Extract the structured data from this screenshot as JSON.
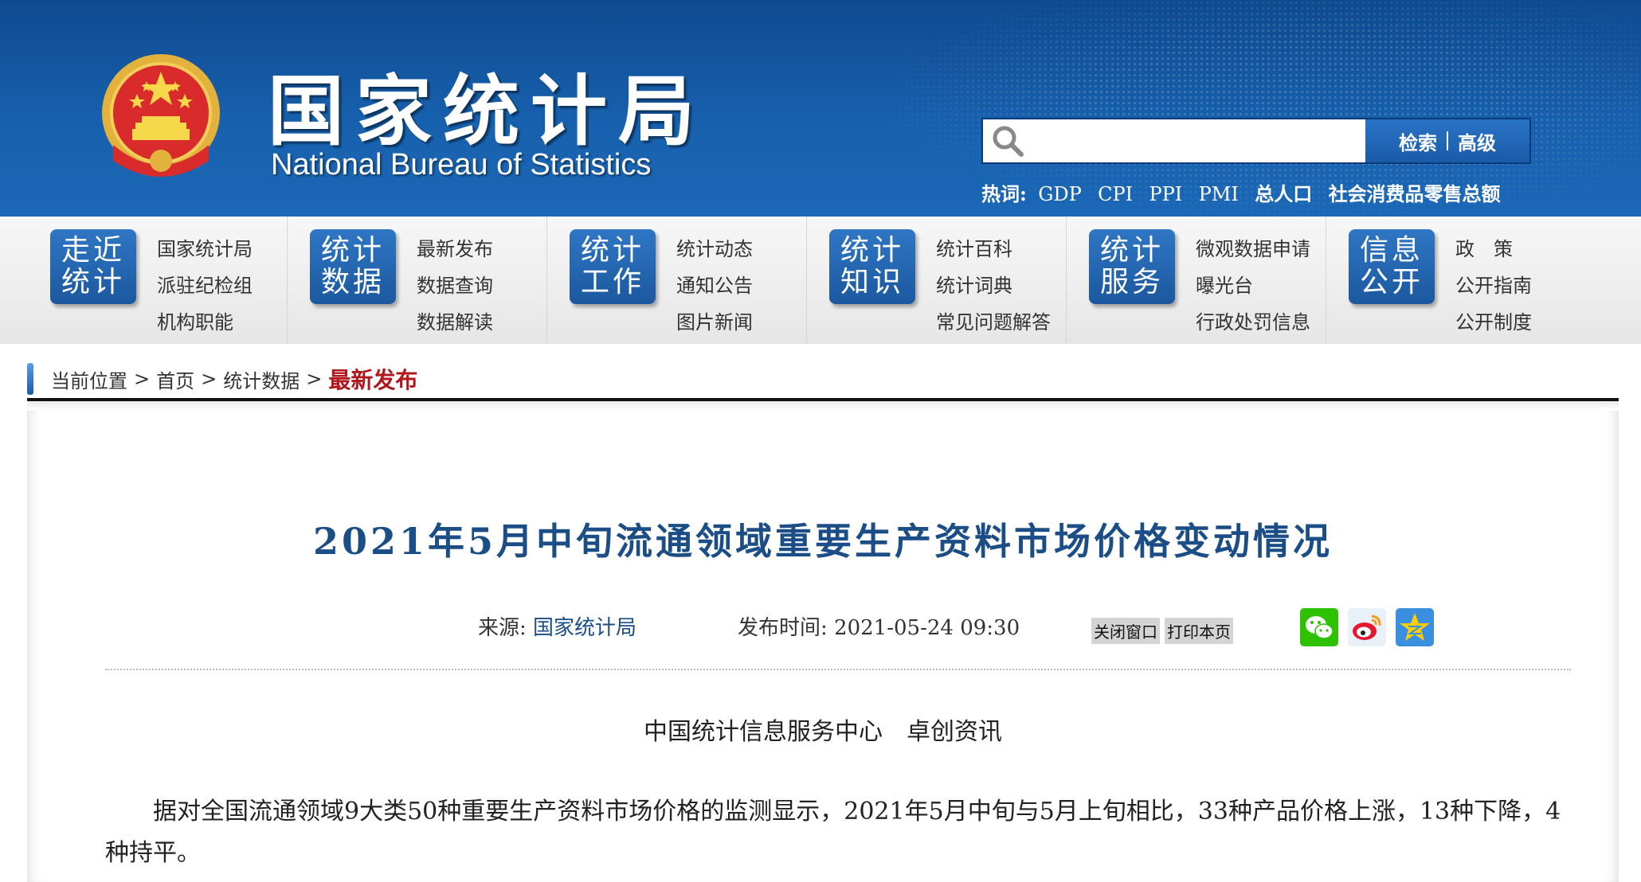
{
  "header": {
    "title_cn": "国家统计局",
    "title_en": "National Bureau of Statistics",
    "emblem_icon": "national-emblem-icon",
    "search": {
      "placeholder": "",
      "search_label": "检索",
      "advanced_label": "高级"
    },
    "hotwords": {
      "label": "热词:",
      "items": [
        "GDP",
        "CPI",
        "PPI",
        "PMI",
        "总人口",
        "社会消费品零售总额"
      ]
    }
  },
  "nav": [
    {
      "badge": [
        "走近",
        "统计"
      ],
      "links": [
        "国家统计局",
        "派驻纪检组",
        "机构职能"
      ]
    },
    {
      "badge": [
        "统计",
        "数据"
      ],
      "links": [
        "最新发布",
        "数据查询",
        "数据解读"
      ]
    },
    {
      "badge": [
        "统计",
        "工作"
      ],
      "links": [
        "统计动态",
        "通知公告",
        "图片新闻"
      ]
    },
    {
      "badge": [
        "统计",
        "知识"
      ],
      "links": [
        "统计百科",
        "统计词典",
        "常见问题解答"
      ]
    },
    {
      "badge": [
        "统计",
        "服务"
      ],
      "links": [
        "微观数据申请",
        "曝光台",
        "行政处罚信息"
      ]
    },
    {
      "badge": [
        "信息",
        "公开"
      ],
      "links": [
        "政　策",
        "公开指南",
        "公开制度"
      ]
    }
  ],
  "breadcrumb": {
    "label": "当前位置",
    "items": [
      "首页",
      "统计数据"
    ],
    "current": "最新发布"
  },
  "article": {
    "title": "2021年5月中旬流通领域重要生产资料市场价格变动情况",
    "source_label": "来源:",
    "source": "国家统计局",
    "time_label": "发布时间:",
    "time": "2021-05-24 09:30",
    "close_label": "关闭窗口",
    "print_label": "打印本页",
    "share_icons": [
      "wechat-icon",
      "weibo-icon",
      "qzone-icon"
    ],
    "byline": "中国统计信息服务中心　卓创资讯",
    "paragraph": "据对全国流通领域9大类50种重要生产资料市场价格的监测显示，2021年5月中旬与5月上旬相比，33种产品价格上涨，13种下降，4种持平。"
  },
  "colors": {
    "header_blue": "#1760ad",
    "title_blue": "#1b4d87",
    "current_red": "#b2171d"
  }
}
